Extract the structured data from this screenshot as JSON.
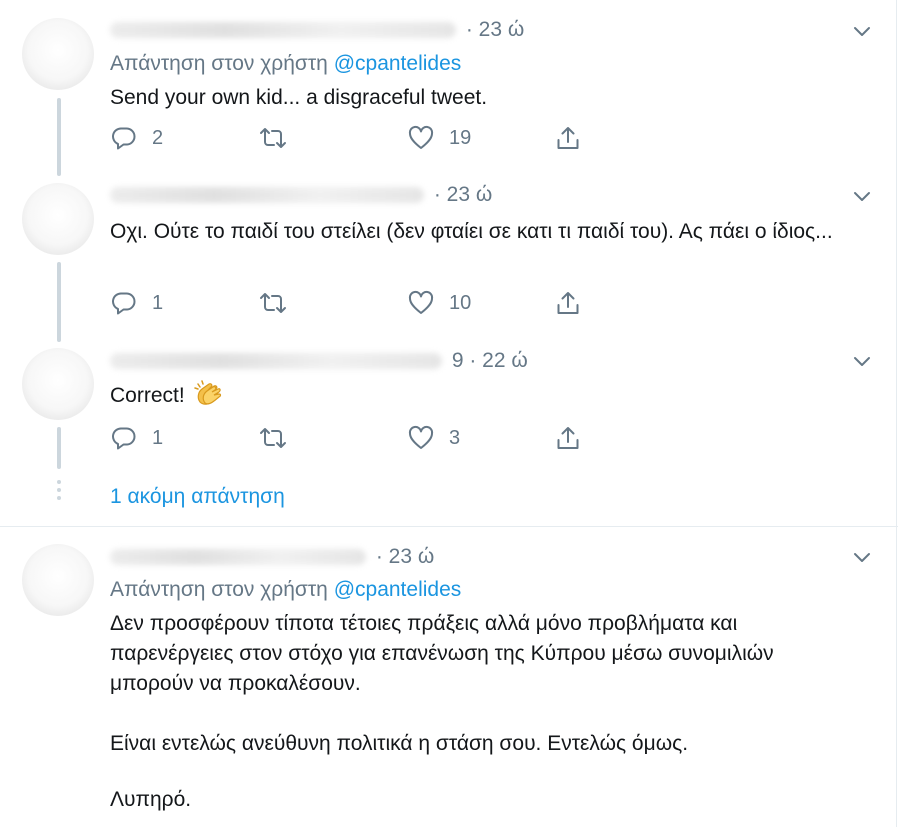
{
  "tweets": [
    {
      "time": "· 23 ώ",
      "reply_prefix": "Απάντηση στον χρήστη",
      "reply_handle": "@cpantelides",
      "text": "Send your own kid... a disgraceful tweet.",
      "replies": "2",
      "likes": "19"
    },
    {
      "time": "· 23 ώ",
      "text": "Οχι. Ούτε το παιδί του στείλει (δεν φταίει σε κατι τι παιδί του). Ας πάει ο ίδιος...",
      "replies": "1",
      "likes": "10"
    },
    {
      "time": "9 · 22 ώ",
      "text": "Correct!",
      "replies": "1",
      "likes": "3"
    },
    {
      "time": "· 23 ώ",
      "reply_prefix": "Απάντηση στον χρήστη",
      "reply_handle": "@cpantelides",
      "paragraphs": [
        "Δεν προσφέρουν τίποτα τέτοιες πράξεις αλλά μόνο προβλήματα και παρενέργειες στον στόχο για επανένωση της Κύπρου μέσω συνομιλιών μπορούν να προκαλέσουν.",
        "Είναι εντελώς ανεύθυνη πολιτικά η στάση σου. Εντελώς όμως.",
        "Λυπηρό."
      ]
    }
  ],
  "more_replies": "1 ακόμη απάντηση",
  "icons": {
    "reply": "reply-icon",
    "retweet": "retweet-icon",
    "like": "heart-icon",
    "share": "share-icon",
    "menu": "chevron-down-icon",
    "emoji": "clapping-hands-icon"
  },
  "colors": {
    "text": "#14171a",
    "secondary": "#657786",
    "link": "#1b95e0",
    "thread_line": "#ccd6dd"
  }
}
